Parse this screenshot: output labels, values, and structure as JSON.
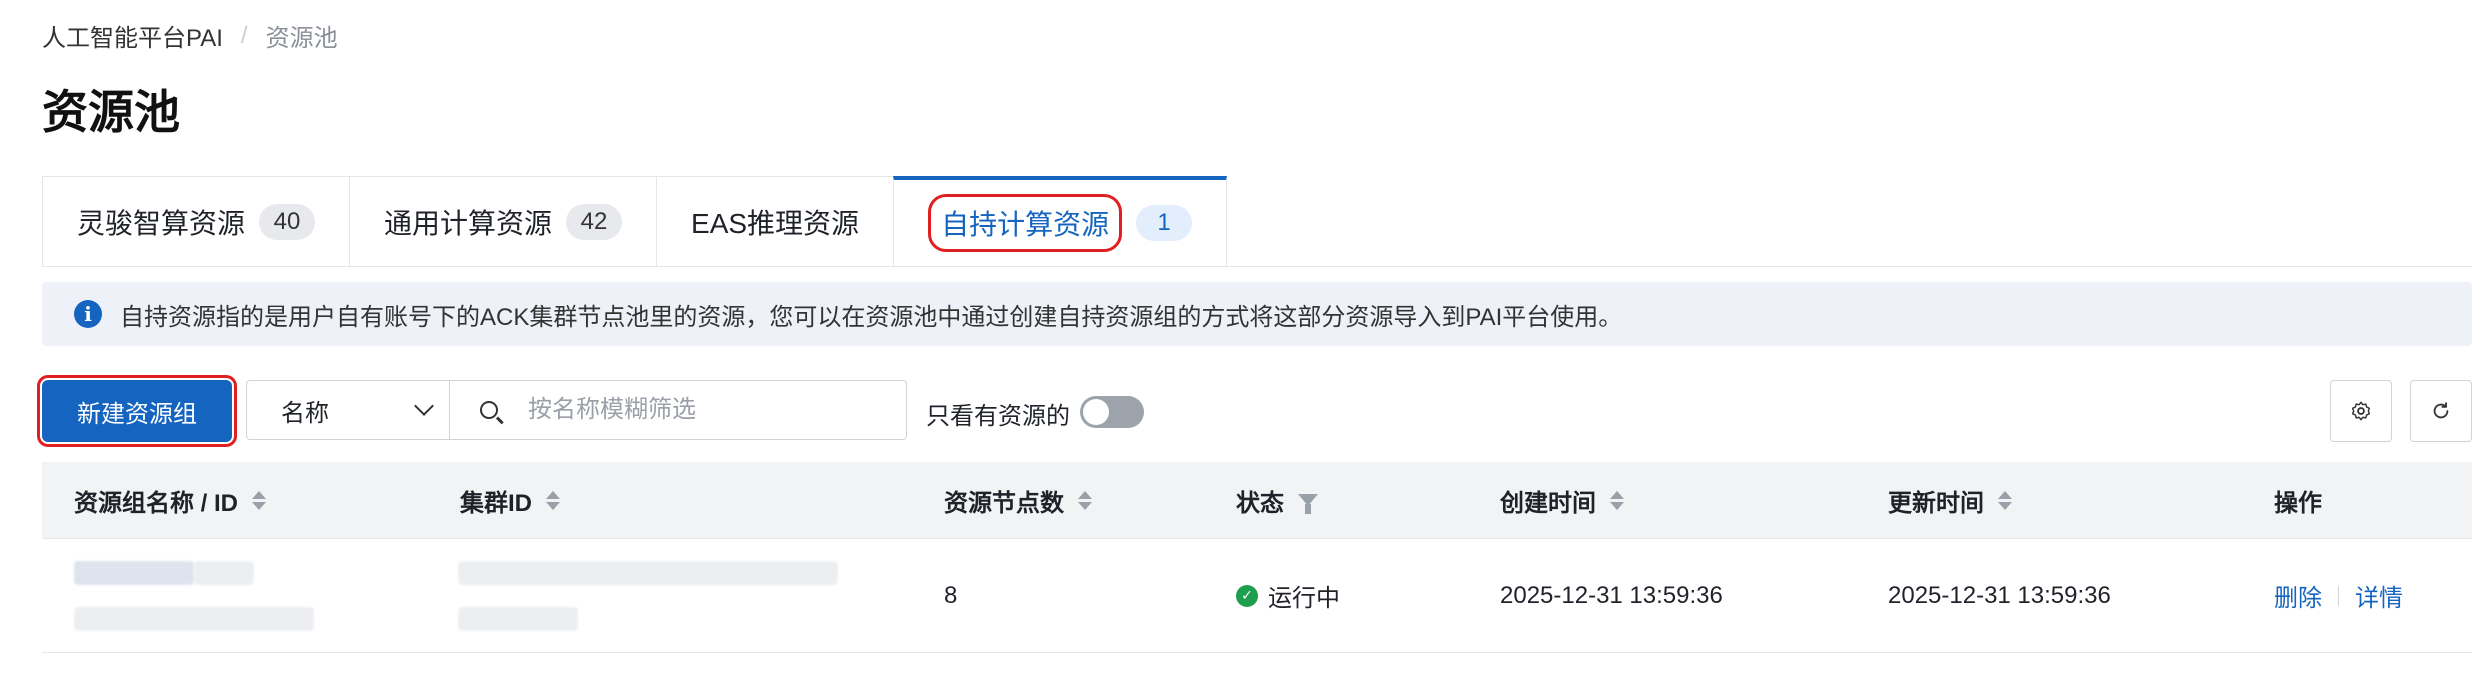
{
  "breadcrumb": {
    "root": "人工智能平台PAI",
    "separator": "/",
    "current": "资源池"
  },
  "page_title": "资源池",
  "tabs": [
    {
      "label": "灵骏智算资源",
      "count": "40",
      "active": false
    },
    {
      "label": "通用计算资源",
      "count": "42",
      "active": false
    },
    {
      "label": "EAS推理资源",
      "count": "",
      "active": false
    },
    {
      "label": "自持计算资源",
      "count": "1",
      "active": true
    }
  ],
  "info_banner": {
    "icon": "info-icon",
    "text": "自持资源指的是用户自有账号下的ACK集群节点池里的资源，您可以在资源池中通过创建自持资源组的方式将这部分资源导入到PAI平台使用。"
  },
  "toolbar": {
    "create_button": "新建资源组",
    "filter_select": "名称",
    "search_placeholder": "按名称模糊筛选",
    "toggle_label": "只看有资源的",
    "toggle_on": false,
    "settings_icon": "gear-icon",
    "refresh_icon": "refresh-icon"
  },
  "table": {
    "columns": [
      {
        "label": "资源组名称 / ID",
        "sortable": true
      },
      {
        "label": "集群ID",
        "sortable": true
      },
      {
        "label": "资源节点数",
        "sortable": true
      },
      {
        "label": "状态",
        "filterable": true
      },
      {
        "label": "创建时间",
        "sortable": true
      },
      {
        "label": "更新时间",
        "sortable": true
      },
      {
        "label": "操作"
      }
    ],
    "rows": [
      {
        "name": "",
        "id": "",
        "cluster_id": "",
        "nodes": "8",
        "status": "运行中",
        "created": "2025-12-31 13:59:36",
        "updated": "2025-12-31 13:59:36",
        "actions": [
          "删除",
          "详情"
        ]
      }
    ]
  },
  "colors": {
    "primary": "#1565c0",
    "highlight_outline": "#e02020",
    "status_running": "#1e9e4f"
  }
}
